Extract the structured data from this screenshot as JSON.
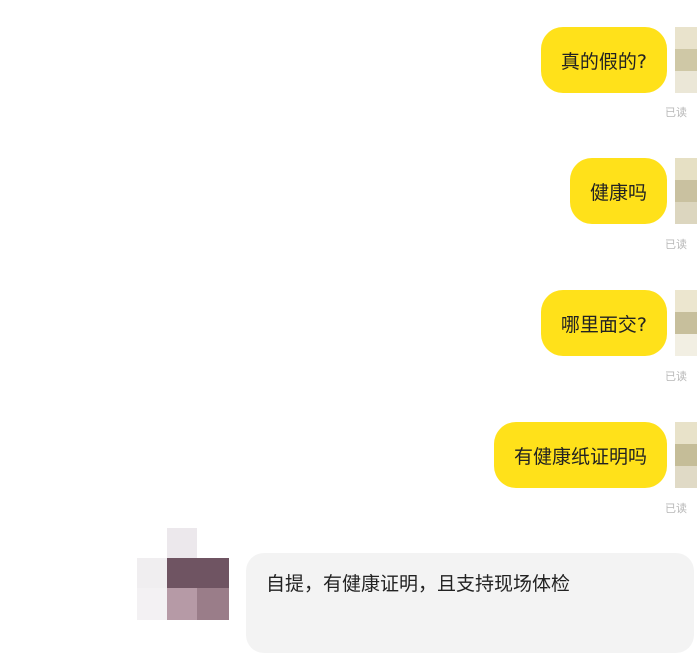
{
  "chat": {
    "outgoing": [
      {
        "text": "真的假的?",
        "status": "已读"
      },
      {
        "text": "健康吗",
        "status": "已读"
      },
      {
        "text": "哪里面交?",
        "status": "已读"
      },
      {
        "text": "有健康纸证明吗",
        "status": "已读"
      }
    ],
    "incoming": [
      {
        "text": "自提，有健康证明，且支持现场体检"
      }
    ]
  },
  "colors": {
    "outgoing_bubble": "#ffe11a",
    "incoming_bubble": "#f3f3f3",
    "read_status": "#b8b8b8"
  }
}
